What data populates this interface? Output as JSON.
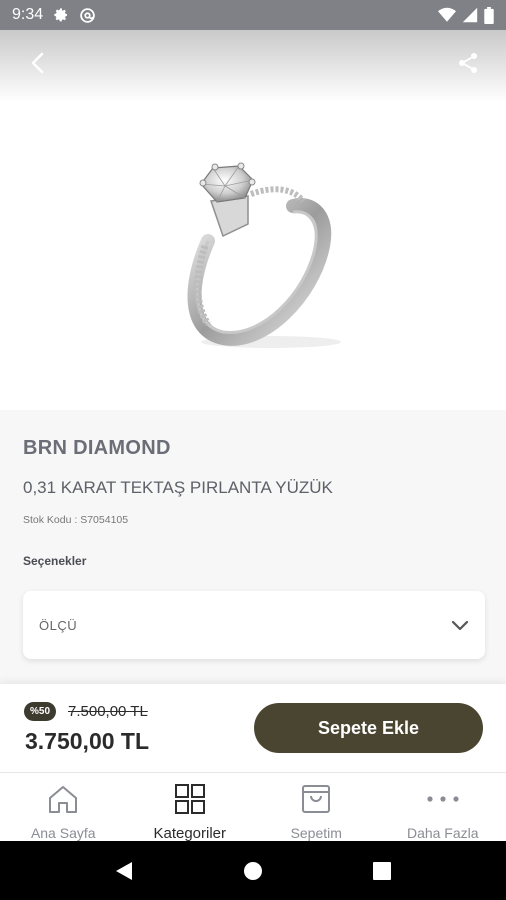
{
  "status_bar": {
    "time": "9:34",
    "icons": [
      "gear-icon",
      "at-sign-icon",
      "wifi-icon",
      "cell-signal-icon",
      "battery-icon"
    ]
  },
  "header": {
    "back_icon": "chevron-left-icon",
    "share_icon": "share-icon"
  },
  "product": {
    "image": "diamond-ring-image",
    "brand": "BRN DIAMOND",
    "title": "0,31 KARAT TEKTAŞ PIRLANTA YÜZÜK",
    "stock_code": "Stok Kodu : S7054105",
    "options_label": "Seçenekler",
    "size_select": {
      "value": "ÖLÇÜ",
      "icon": "chevron-down-icon"
    }
  },
  "pricing": {
    "discount_badge": "%50",
    "old_price": "7.500,00 TL",
    "new_price": "3.750,00 TL",
    "add_to_cart_label": "Sepete Ekle"
  },
  "bottom_nav": {
    "items": [
      {
        "label": "Ana Sayfa",
        "icon": "home-icon",
        "active": false
      },
      {
        "label": "Kategoriler",
        "icon": "grid-icon",
        "active": true
      },
      {
        "label": "Sepetim",
        "icon": "shopping-bag-icon",
        "active": false
      },
      {
        "label": "Daha Fazla",
        "icon": "more-dots-icon",
        "active": false
      }
    ]
  },
  "colors": {
    "accent": "#4a4531",
    "badge": "#3d3a2e",
    "status_bar": "#7f8187",
    "info_bg": "#f7f7f7"
  }
}
